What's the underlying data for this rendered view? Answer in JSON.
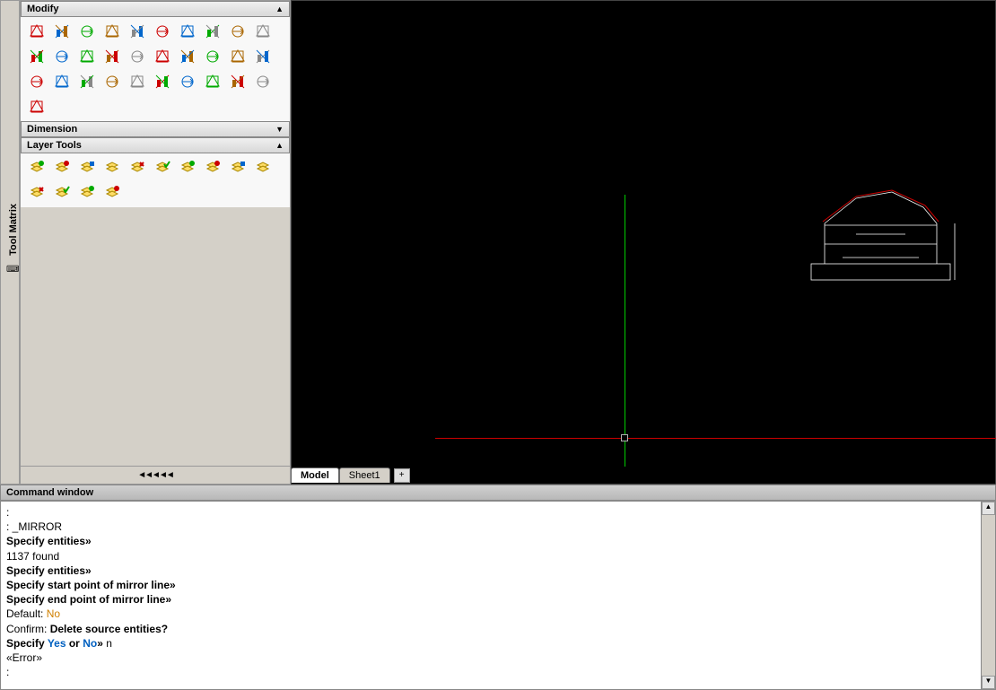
{
  "vertical_tab": {
    "label": "Tool Matrix"
  },
  "panels": {
    "modify": {
      "title": "Modify"
    },
    "dimension": {
      "title": "Dimension"
    },
    "layer_tools": {
      "title": "Layer Tools"
    }
  },
  "modify_icons": [
    "erase-icon",
    "zoom-delete-icon",
    "copy-icon",
    "mirror-icon",
    "offset-icon",
    "move-icon",
    "array-icon",
    "rotate-icon",
    "scale-icon",
    "stretch-icon",
    "trim-icon",
    "extend-icon",
    "break-icon",
    "chamfer-icon",
    "fillet-icon",
    "fillet2-icon",
    "align-icon",
    "lengthen-icon",
    "join-icon",
    "edit-icon",
    "explode-icon",
    "move2-icon",
    "hatch-icon",
    "block-icon",
    "attdef-icon",
    "region-icon",
    "spline-icon",
    "grid1-icon",
    "grid2-icon",
    "grid3-icon",
    "check-icon"
  ],
  "layer_icons": [
    "layer-new-icon",
    "layer-add-icon",
    "layer-props-icon",
    "layer-state1-icon",
    "layer-state2-icon",
    "layer-color-icon",
    "layer-iso-icon",
    "layer-freeze-icon",
    "layer-check-icon",
    "layer-set-icon",
    "layer-on-icon",
    "layer-delete-icon",
    "layer-merge-icon",
    "layer-walk-icon"
  ],
  "scroll_foot": "◄◄◄◄◄",
  "tabs": {
    "model": "Model",
    "sheet1": "Sheet1",
    "plus": "+"
  },
  "command_window": {
    "title": "Command window",
    "lines": {
      "l1_prefix": ": ",
      "l1_cmd": "_MIRROR",
      "l2": "Specify entities»",
      "l3": "1137 found",
      "l4": "Specify entities»",
      "l5": "Specify start point of mirror line»",
      "l6": "Specify end point of mirror line»",
      "l7_a": "Default: ",
      "l7_b": "No",
      "l8_a": "Confirm: ",
      "l8_b": "Delete source entities?",
      "l9_a": "Specify ",
      "l9_yes": "Yes",
      "l9_or": " or ",
      "l9_no": "No",
      "l9_arrow": "»",
      "l9_input": " n",
      "l10": "«Error»",
      "l11": ":"
    }
  }
}
